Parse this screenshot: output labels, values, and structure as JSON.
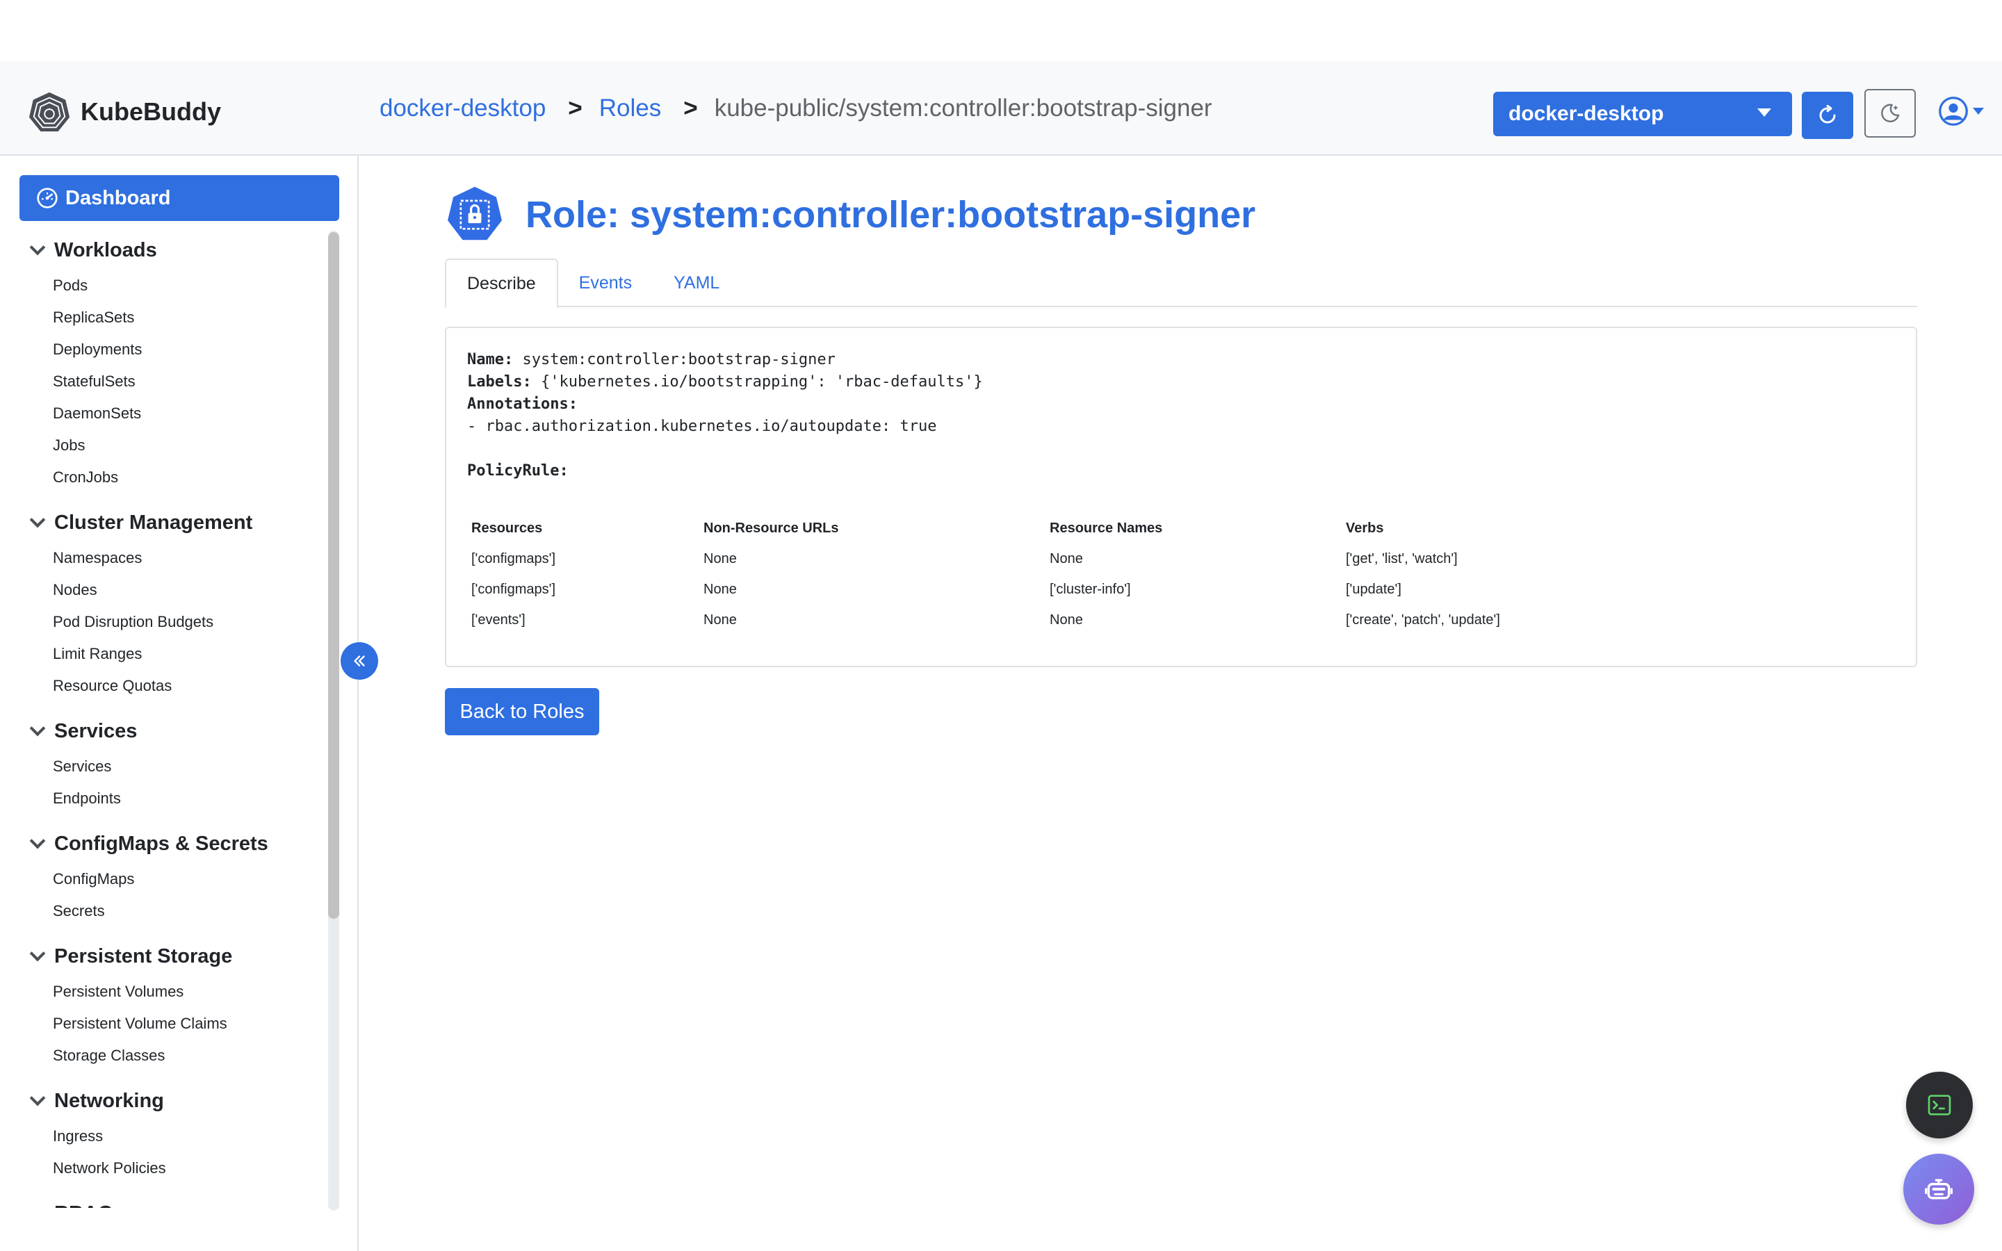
{
  "app": {
    "name": "KubeBuddy"
  },
  "breadcrumb": {
    "context": "docker-desktop",
    "section": "Roles",
    "separator": ">",
    "current": "kube-public/system:controller:bootstrap-signer"
  },
  "header": {
    "context_select": {
      "value": "docker-desktop"
    },
    "icons": {
      "refresh": "refresh-icon",
      "theme": "moon-icon",
      "user": "user-circle-icon"
    }
  },
  "sidebar": {
    "dashboard_label": "Dashboard",
    "sections": [
      {
        "title": "Workloads",
        "items": [
          "Pods",
          "ReplicaSets",
          "Deployments",
          "StatefulSets",
          "DaemonSets",
          "Jobs",
          "CronJobs"
        ]
      },
      {
        "title": "Cluster Management",
        "items": [
          "Namespaces",
          "Nodes",
          "Pod Disruption Budgets",
          "Limit Ranges",
          "Resource Quotas"
        ]
      },
      {
        "title": "Services",
        "items": [
          "Services",
          "Endpoints"
        ]
      },
      {
        "title": "ConfigMaps & Secrets",
        "items": [
          "ConfigMaps",
          "Secrets"
        ]
      },
      {
        "title": "Persistent Storage",
        "items": [
          "Persistent Volumes",
          "Persistent Volume Claims",
          "Storage Classes"
        ]
      },
      {
        "title": "Networking",
        "items": [
          "Ingress",
          "Network Policies"
        ]
      },
      {
        "title": "RBAC",
        "items": []
      }
    ]
  },
  "main": {
    "title": "Role: system:controller:bootstrap-signer",
    "tabs": [
      "Describe",
      "Events",
      "YAML"
    ],
    "active_tab": "Describe",
    "describe": {
      "name_key": "Name:",
      "name_value": "system:controller:bootstrap-signer",
      "labels_key": "Labels:",
      "labels_value": "{'kubernetes.io/bootstrapping': 'rbac-defaults'}",
      "annotations_key": "Annotations:",
      "annotation_line": "- rbac.authorization.kubernetes.io/autoupdate: true",
      "policy_key": "PolicyRule:",
      "columns": [
        "Resources",
        "Non-Resource URLs",
        "Resource Names",
        "Verbs"
      ],
      "rows": [
        [
          "['configmaps']",
          "None",
          "None",
          "['get', 'list', 'watch']"
        ],
        [
          "['configmaps']",
          "None",
          "['cluster-info']",
          "['update']"
        ],
        [
          "['events']",
          "None",
          "None",
          "['create', 'patch', 'update']"
        ]
      ]
    },
    "back_button": "Back to Roles"
  },
  "colors": {
    "primary": "#2f6fe0",
    "header_bg": "#f8f9fa",
    "border": "#dee2e6"
  }
}
